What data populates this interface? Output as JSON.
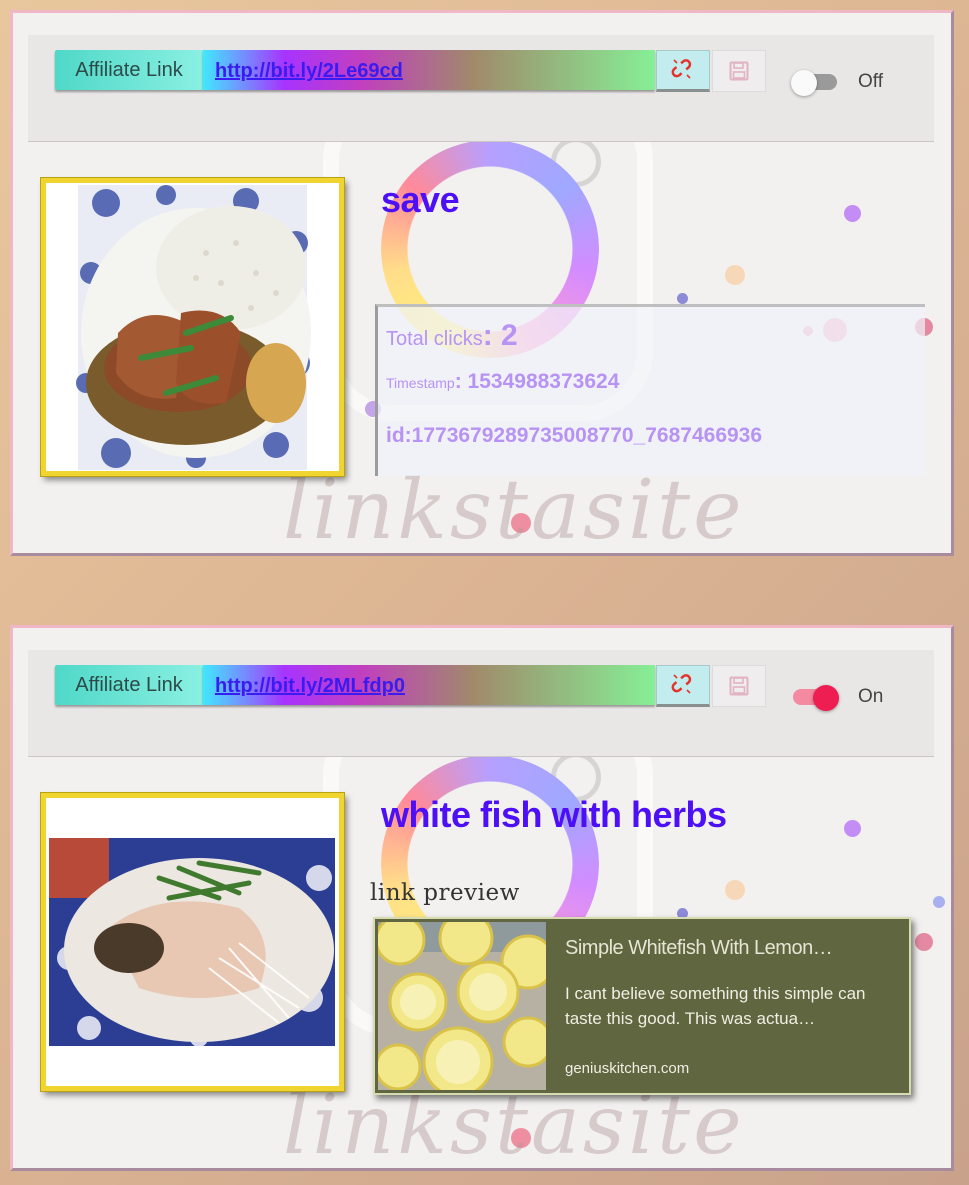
{
  "cards": [
    {
      "affiliate_label": "Affiliate Link",
      "url": "http://bit.ly/2Le69cd",
      "toggle_label": "Off",
      "toggle_state": "off",
      "title": "save",
      "stats": {
        "total_clicks_label": "Total clicks",
        "total_clicks_value": ": 2",
        "timestamp_label": "Timestamp",
        "timestamp_value": ": 1534988373624",
        "id_text": "id:1773679289735008770_7687466936"
      },
      "watermark": "linkstasite"
    },
    {
      "affiliate_label": "Affiliate Link",
      "url": "http://bit.ly/2MLfdp0",
      "toggle_label": "On",
      "toggle_state": "on",
      "title": "white fish with herbs",
      "link_preview": {
        "section_label": "link preview",
        "title": "Simple Whitefish With Lemon…",
        "description": "I cant believe something this simple can taste this good. This was actua…",
        "domain": "geniuskitchen.com"
      },
      "watermark": "linkstasite"
    }
  ],
  "icons": {
    "unlink": "broken-link-icon",
    "save": "floppy-disk-icon"
  },
  "colors": {
    "title": "#4d0ff5",
    "stat_text": "#b793f4",
    "toggle_on": "#ef1e52",
    "frame": "#f0d430"
  }
}
